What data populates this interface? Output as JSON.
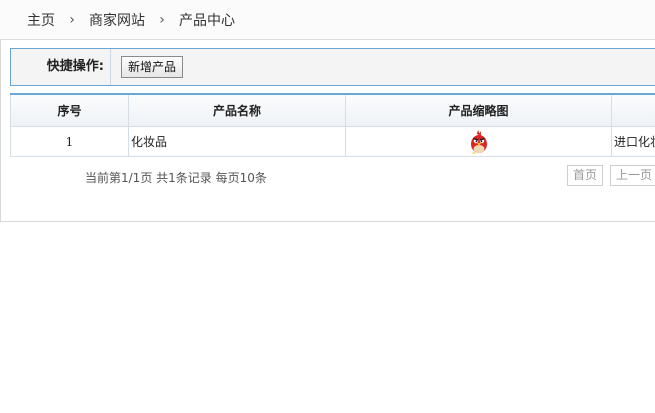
{
  "breadcrumb": {
    "items": [
      "主页",
      "商家网站",
      "产品中心"
    ],
    "separator": "›"
  },
  "quickbar": {
    "label": "快捷操作:",
    "add_button": "新增产品"
  },
  "table": {
    "headers": [
      "序号",
      "产品名称",
      "产品缩略图",
      ""
    ],
    "rows": [
      {
        "index": "1",
        "name": "化妆品",
        "thumbnail_icon": "angry-bird-icon",
        "desc": "进口化妆品"
      }
    ]
  },
  "pager": {
    "info": "当前第1/1页 共1条记录 每页10条",
    "first": "首页",
    "prev": "上一页"
  },
  "colors": {
    "accent_border": "#6aa6d8",
    "quickbar_bg": "#f4f4f4",
    "thumb_red": "#d8262b",
    "thumb_yellow": "#f2c40c"
  }
}
